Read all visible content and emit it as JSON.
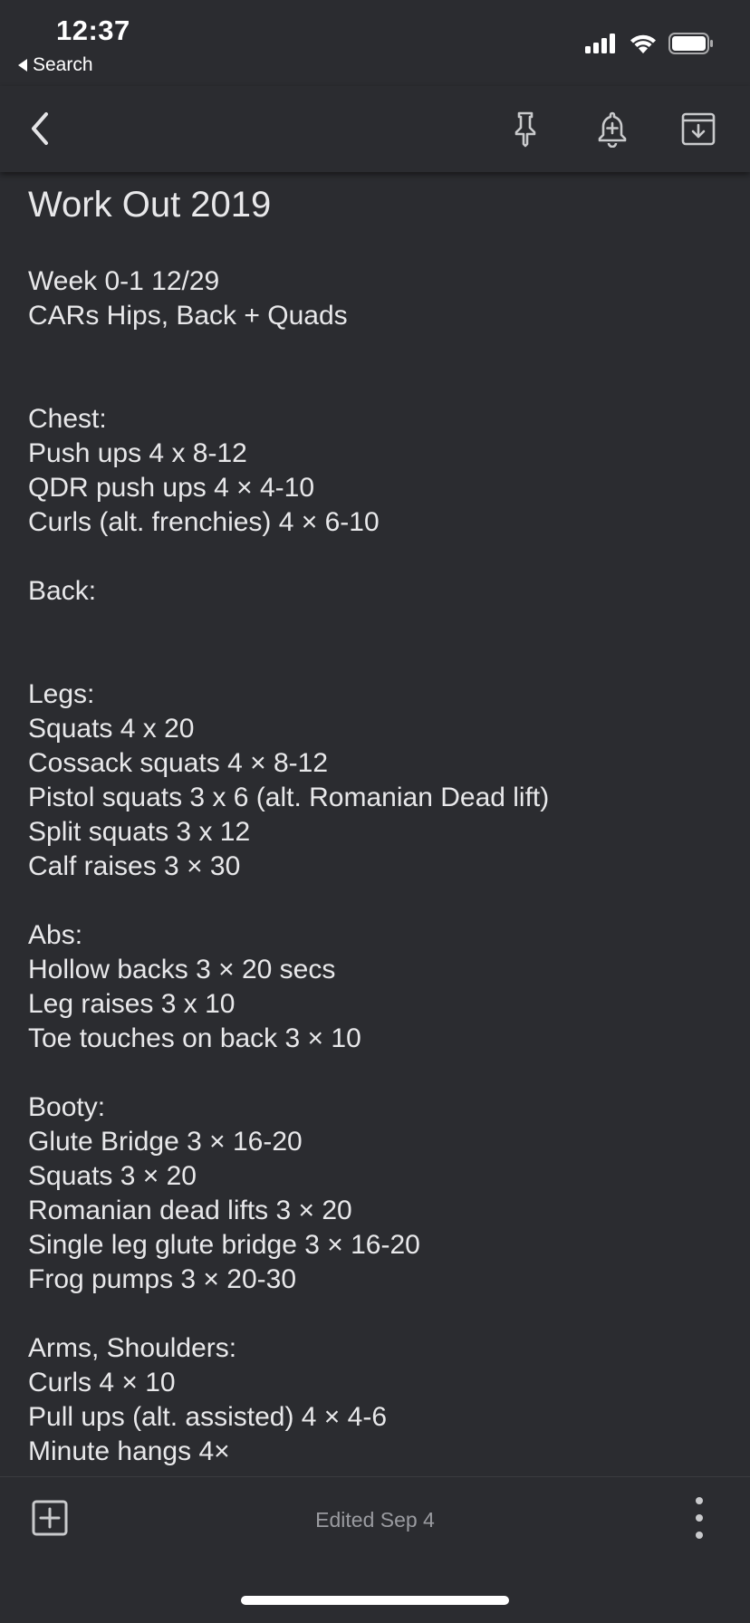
{
  "status_bar": {
    "time": "12:37",
    "back_app_label": "Search",
    "icons": [
      "signal-icon",
      "wifi-icon",
      "battery-icon"
    ]
  },
  "toolbar": {
    "icons": [
      "back-arrow-icon",
      "pin-icon",
      "reminder-bell-icon",
      "archive-icon"
    ]
  },
  "note": {
    "title": "Work Out 2019",
    "lines": [
      "Week 0-1 12/29",
      "CARs Hips, Back + Quads",
      "",
      "",
      "Chest:",
      "Push ups 4 x 8-12",
      "QDR push ups 4 × 4-10",
      "Curls (alt. frenchies) 4 × 6-10",
      "",
      "Back:",
      "",
      "",
      "Legs:",
      "Squats 4 x 20",
      "Cossack squats 4 × 8-12",
      "Pistol squats 3 x 6 (alt. Romanian Dead lift)",
      "Split squats 3 x 12",
      "Calf raises 3 × 30",
      "",
      "Abs:",
      "Hollow backs 3 × 20 secs",
      "Leg raises 3 x 10",
      "Toe touches on back 3 × 10",
      "",
      "Booty:",
      "Glute Bridge 3 × 16-20",
      "Squats 3 × 20",
      "Romanian dead lifts 3 × 20",
      "Single leg glute bridge 3 × 16-20",
      "Frog pumps 3 × 20-30",
      "",
      "Arms, Shoulders:",
      "Curls 4 × 10",
      "Pull ups (alt. assisted) 4 × 4-6",
      "Minute hangs 4×"
    ]
  },
  "bottom_bar": {
    "edited": "Edited Sep 4",
    "icons": [
      "add-box-icon",
      "more-vertical-icon"
    ]
  },
  "colors": {
    "background": "#2b2c30",
    "text": "#e8e8ea",
    "muted": "#9a9ba0"
  }
}
